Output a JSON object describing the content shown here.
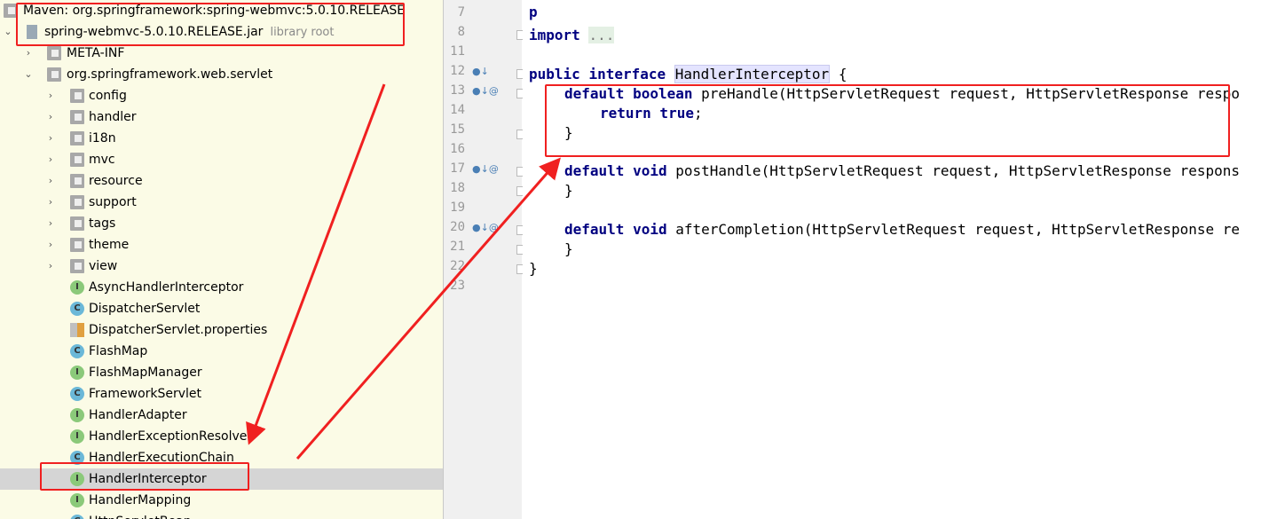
{
  "tree": {
    "maven_label": "Maven: org.springframework:spring-webmvc:5.0.10.RELEASE",
    "jar_label": "spring-webmvc-5.0.10.RELEASE.jar",
    "jar_hint": "library root",
    "meta_inf": "META-INF",
    "package": "org.springframework.web.servlet",
    "folders": [
      "config",
      "handler",
      "i18n",
      "mvc",
      "resource",
      "support",
      "tags",
      "theme",
      "view"
    ],
    "files": [
      {
        "name": "AsyncHandlerInterceptor",
        "badge": "I"
      },
      {
        "name": "DispatcherServlet",
        "badge": "C"
      },
      {
        "name": "DispatcherServlet.properties",
        "badge": "P"
      },
      {
        "name": "FlashMap",
        "badge": "C"
      },
      {
        "name": "FlashMapManager",
        "badge": "I"
      },
      {
        "name": "FrameworkServlet",
        "badge": "C"
      },
      {
        "name": "HandlerAdapter",
        "badge": "I"
      },
      {
        "name": "HandlerExceptionResolver",
        "badge": "I"
      },
      {
        "name": "HandlerExecutionChain",
        "badge": "C"
      },
      {
        "name": "HandlerInterceptor",
        "badge": "I"
      },
      {
        "name": "HandlerMapping",
        "badge": "I"
      },
      {
        "name": "HttpServletBean",
        "badge": "C"
      }
    ],
    "selected": "HandlerInterceptor"
  },
  "editor": {
    "line_numbers": [
      "7",
      "8",
      "11",
      "12",
      "13",
      "14",
      "15",
      "16",
      "17",
      "18",
      "19",
      "20",
      "21",
      "22",
      "23"
    ],
    "fold_text": "...",
    "lines": {
      "l8_kw": "import",
      "l12_kw1": "public",
      "l12_kw2": "interface",
      "l12_name": "HandlerInterceptor",
      "l12_brace": "{",
      "l13_kw": "default boolean",
      "l13_rest": "preHandle(HttpServletRequest request, HttpServletResponse respo",
      "l14_kw": "return true",
      "l14_semi": ";",
      "l15": "}",
      "l17_kw": "default void",
      "l17_rest": "postHandle(HttpServletRequest request, HttpServletResponse respons",
      "l18": "}",
      "l20_kw": "default void",
      "l20_rest": "afterCompletion(HttpServletRequest request, HttpServletResponse re",
      "l21": "}",
      "l22": "}"
    }
  },
  "colors": {
    "annotation": "#f02020",
    "keyword": "#000080",
    "tree_bg": "#fbfbe6"
  }
}
